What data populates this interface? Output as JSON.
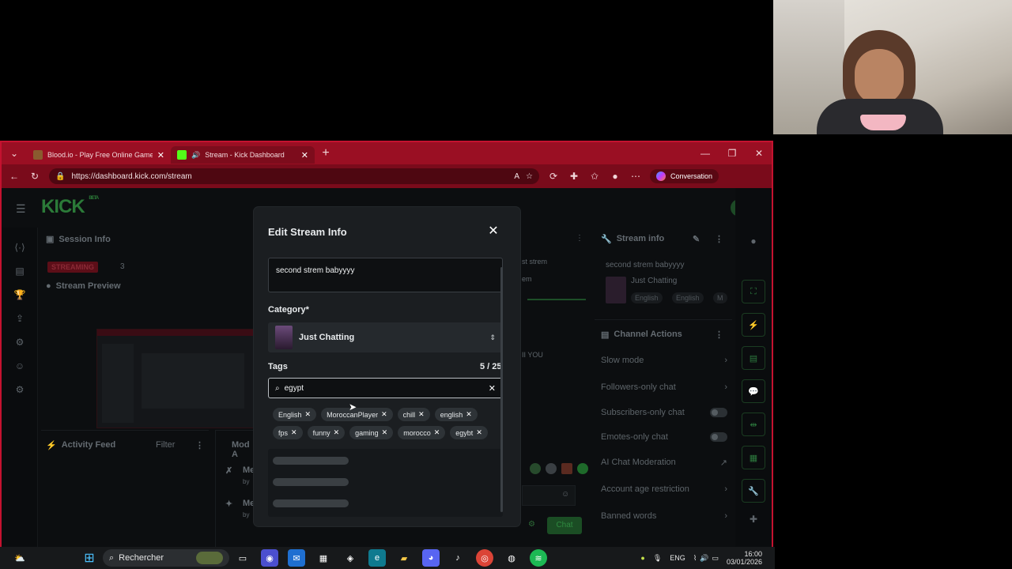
{
  "browser": {
    "tabs": [
      {
        "title": "Blood.io - Play Free Online Games!",
        "active": false,
        "favicon_color": "#8a5b2f"
      },
      {
        "title": "Stream - Kick Dashboard",
        "active": true,
        "favicon_color": "#53fc18"
      }
    ],
    "url": "https://dashboard.kick.com/stream",
    "conversation_label": "Conversation"
  },
  "dashboard": {
    "logo": "KICK",
    "logo_badge": "BETA",
    "session_info": {
      "label": "Session Info",
      "status": "STREAMING",
      "count": "3"
    },
    "stream_preview": {
      "label": "Stream Preview"
    },
    "activity_feed": {
      "label": "Activity Feed",
      "filter": "Filter"
    },
    "mod_actions": {
      "label": "Mod A",
      "items": [
        "Me",
        "by",
        "Me",
        "by"
      ]
    },
    "chat_fragments": {
      "line1": "st strem",
      "line2": "em",
      "line3": "II YOU",
      "send_label": "Chat"
    },
    "stream_info": {
      "label": "Stream info",
      "title": "second strem babyyyy",
      "category": "Just Chatting",
      "tags": [
        "English",
        "English",
        "M"
      ]
    },
    "channel_actions": {
      "label": "Channel Actions",
      "items": [
        {
          "label": "Slow mode",
          "kind": "chevron"
        },
        {
          "label": "Followers-only chat",
          "kind": "chevron"
        },
        {
          "label": "Subscribers-only chat",
          "kind": "toggle"
        },
        {
          "label": "Emotes-only chat",
          "kind": "toggle"
        },
        {
          "label": "AI Chat Moderation",
          "kind": "ext"
        },
        {
          "label": "Account age restriction",
          "kind": "chevron"
        },
        {
          "label": "Banned words",
          "kind": "chevron"
        }
      ]
    }
  },
  "modal": {
    "title": "Edit Stream Info",
    "stream_title": "second  strem  babyyyy",
    "category_label": "Category*",
    "category_value": "Just Chatting",
    "tags_label": "Tags",
    "tags_count": "5 / 25",
    "tag_search_value": "egypt",
    "tag_row_1": [
      "English",
      "MoroccanPlayer",
      "chill",
      "english"
    ],
    "tag_row_2": [
      "fps",
      "funny",
      "gaming",
      "morocco",
      "egybt"
    ]
  },
  "taskbar": {
    "search_placeholder": "Rechercher",
    "lang": "ENG",
    "time": "16:00",
    "date": "03/01/2026"
  },
  "colors": {
    "kick_green": "#53fc18",
    "browser_red": "#c4122f"
  }
}
